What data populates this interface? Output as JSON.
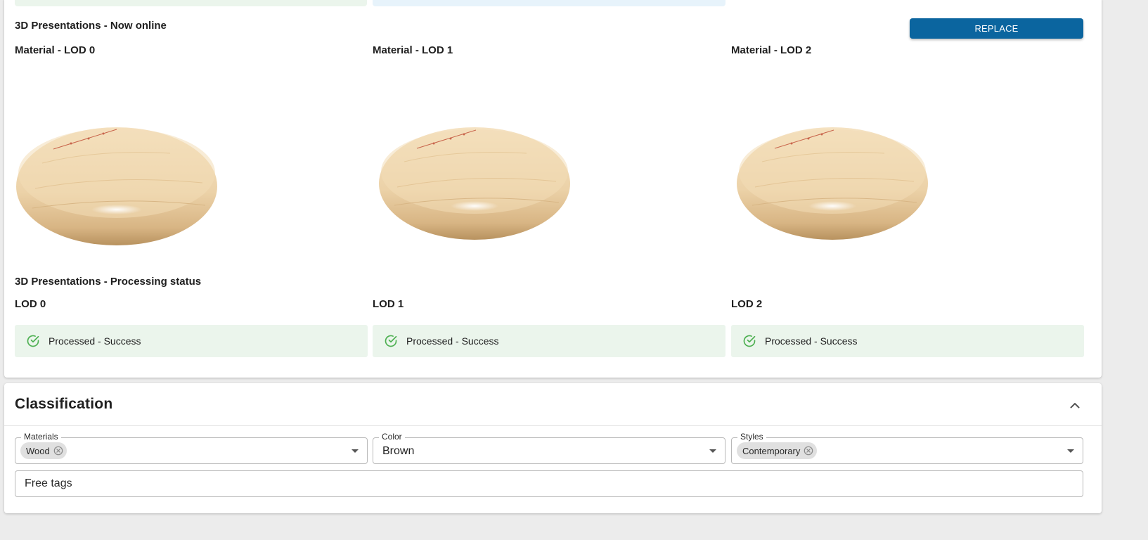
{
  "presentations": {
    "online_title": "3D Presentations - Now online",
    "replace_label": "REPLACE",
    "materials": [
      {
        "label": "Material - LOD 0"
      },
      {
        "label": "Material - LOD 1"
      },
      {
        "label": "Material - LOD 2"
      }
    ],
    "processing_title": "3D Presentations - Processing status",
    "statuses": [
      {
        "label": "LOD 0",
        "status": "Processed - Success"
      },
      {
        "label": "LOD 1",
        "status": "Processed - Success"
      },
      {
        "label": "LOD 2",
        "status": "Processed - Success"
      }
    ]
  },
  "classification": {
    "title": "Classification",
    "materials": {
      "label": "Materials",
      "chip": "Wood"
    },
    "color": {
      "label": "Color",
      "value": "Brown"
    },
    "styles": {
      "label": "Styles",
      "chip": "Contemporary"
    },
    "free_tags_placeholder": "Free tags"
  },
  "colors": {
    "primary_button": "#0b659f",
    "success_bg": "#ebf5ec",
    "success_icon": "#4caf50",
    "wood_light": "#f3ddb8",
    "wood_dark": "#c79f6f"
  },
  "icons": {
    "status": "check-circle-outline-icon",
    "collapse": "chevron-up-icon",
    "chip_delete": "cancel-icon",
    "dropdown": "arrow-drop-down-icon"
  }
}
